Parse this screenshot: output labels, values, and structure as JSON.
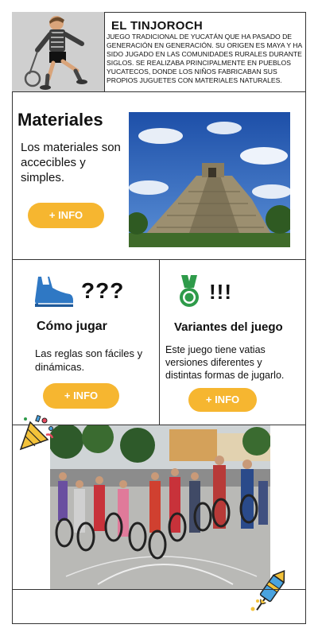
{
  "header": {
    "title": "EL TINJOROCH",
    "description": "JUEGO TRADICIONAL DE YUCATÁN QUE HA PASADO DE GENERACIÓN EN GENERACIÓN. SU ORIGEN ES MAYA Y HA SIDO JUGADO EN LAS COMUNIDADES RURALES DURANTE SIGLOS. SE REALIZABA PRINCIPALMENTE EN PUEBLOS YUCATECOS, DONDE LOS NIÑOS FABRICABAN SUS PROPIOS JUGUETES CON MATERIALES NATURALES."
  },
  "materiales": {
    "title": "Materiales",
    "text": "Los materiales son accecibles y simples.",
    "button": "+ INFO"
  },
  "como_jugar": {
    "symbol": "???",
    "title": "Cómo jugar",
    "text": "Las reglas son fáciles y dinámicas.",
    "button": "+ INFO"
  },
  "variantes": {
    "symbol": "!!!",
    "title": "Variantes del juego",
    "text": "Este juego tiene vatias versiones diferentes y distintas formas de jugarlo.",
    "button": "+ INFO"
  },
  "colors": {
    "accent": "#f6b630",
    "shoe": "#2f78c4",
    "medal": "#2e9b4a"
  },
  "icons": {
    "shoe": "sneaker-icon",
    "medal": "medal-icon",
    "party": "party-popper-icon",
    "firework": "firework-rocket-icon"
  }
}
